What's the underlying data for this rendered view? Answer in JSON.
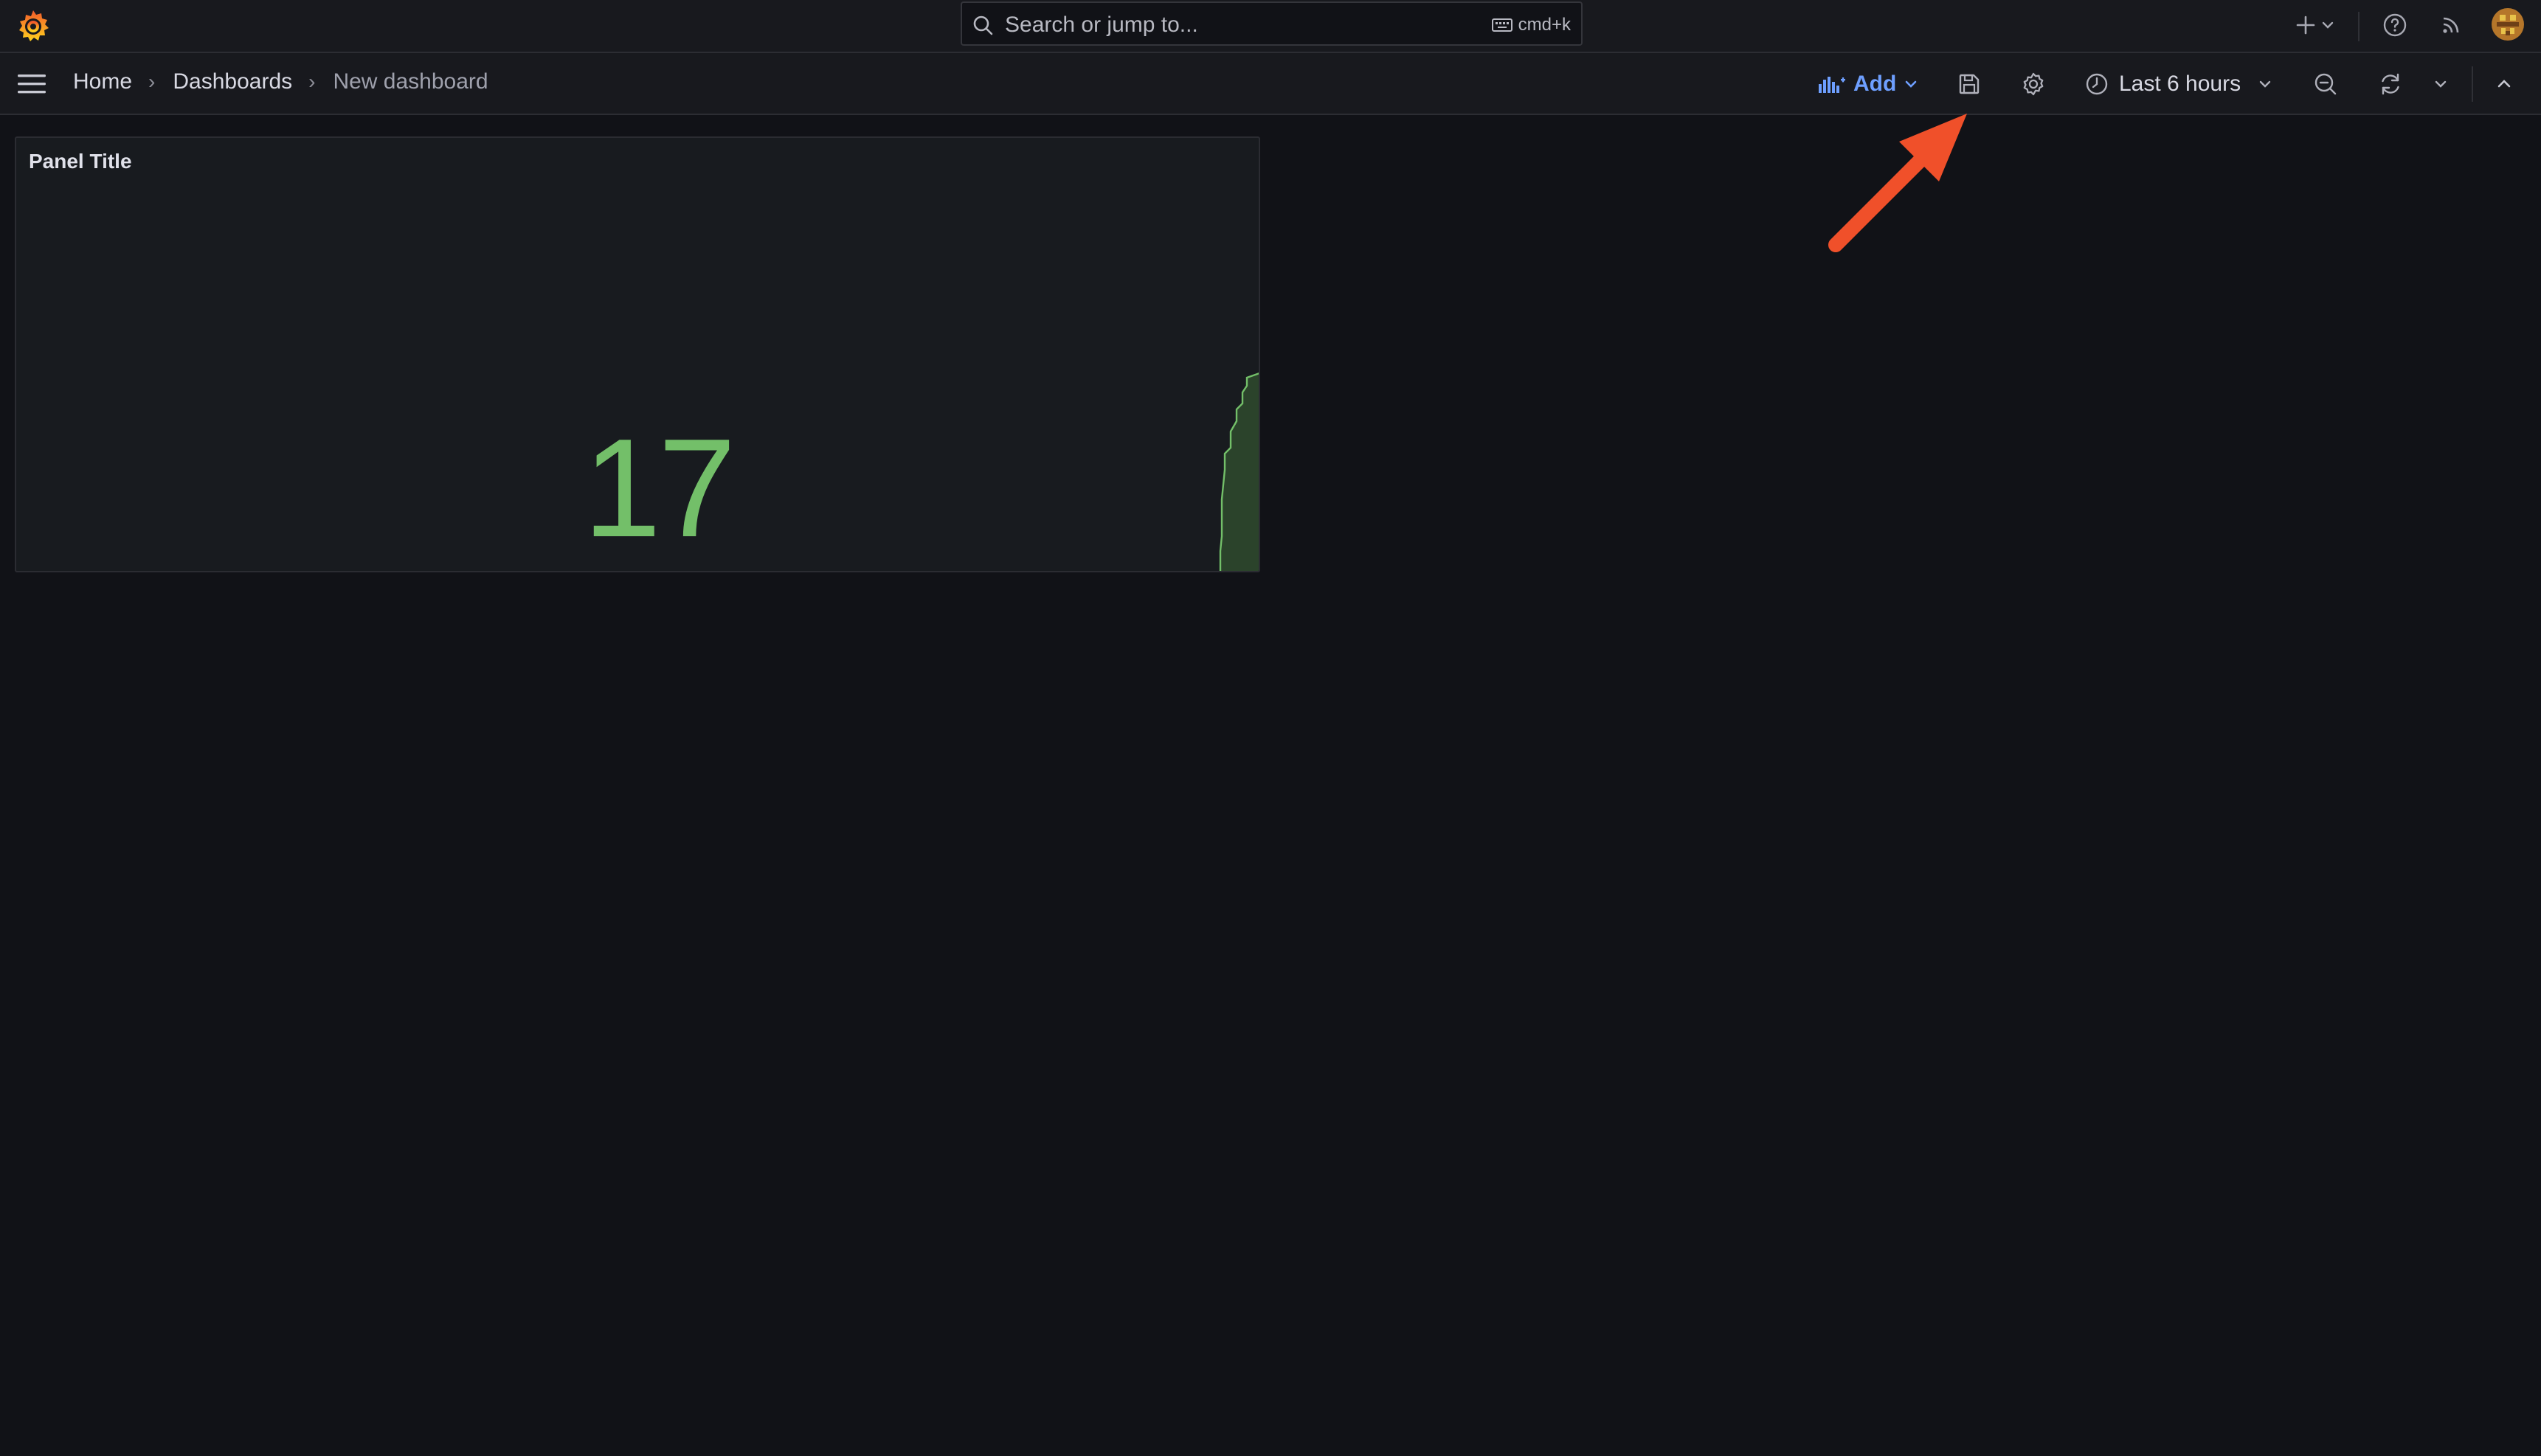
{
  "topbar": {
    "search": {
      "placeholder": "Search or jump to...",
      "shortcut": "cmd+k"
    },
    "icons": [
      "grafana-logo-icon",
      "search-icon",
      "keyboard-icon",
      "plus-icon",
      "chevron-down-icon",
      "help-icon",
      "news-feed-icon",
      "user-avatar"
    ]
  },
  "breadcrumbs": [
    "Home",
    "Dashboards",
    "New dashboard"
  ],
  "toolbar": {
    "add_label": "Add",
    "time_range": "Last 6 hours",
    "icons": [
      "add-panel-icon",
      "save-dashboard-icon",
      "settings-icon",
      "clock-icon",
      "zoom-out-icon",
      "refresh-icon",
      "chevron-down-icon",
      "collapse-icon"
    ]
  },
  "panel": {
    "title": "Panel Title",
    "value": "17",
    "value_color": "#73bf69"
  },
  "colors": {
    "accent": "#6e9fff",
    "background": "#111217",
    "annotation_arrow": "#f0502a"
  }
}
